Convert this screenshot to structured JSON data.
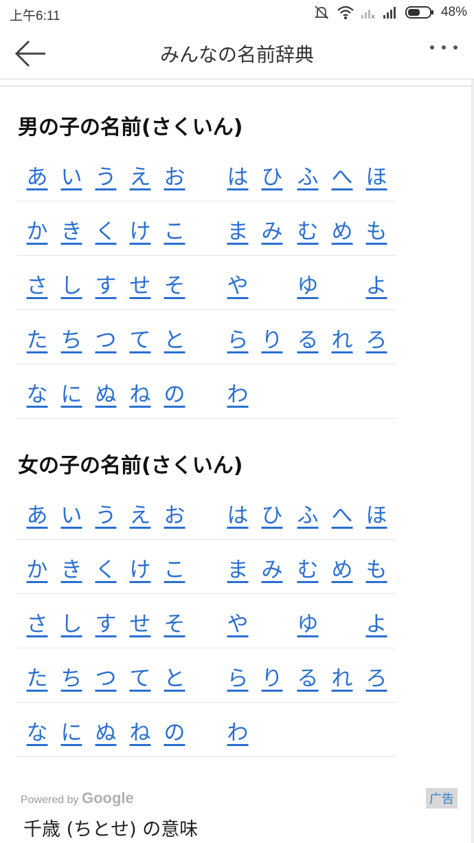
{
  "status_bar": {
    "time": "上午6:11",
    "battery": "48%",
    "icons": [
      "mute-bell-icon",
      "wifi-icon",
      "signal-x-icon",
      "signal-icon",
      "battery-icon"
    ]
  },
  "nav": {
    "title": "みんなの名前辞典",
    "back_icon": "back-arrow-icon",
    "more_icon": "more-dots-icon"
  },
  "sections": [
    {
      "title": "男の子の名前(さくいん)",
      "rows": [
        [
          "あ",
          "い",
          "う",
          "え",
          "お",
          "は",
          "ひ",
          "ふ",
          "へ",
          "ほ"
        ],
        [
          "か",
          "き",
          "く",
          "け",
          "こ",
          "ま",
          "み",
          "む",
          "め",
          "も"
        ],
        [
          "さ",
          "し",
          "す",
          "せ",
          "そ",
          "や",
          "",
          "ゆ",
          "",
          "よ"
        ],
        [
          "た",
          "ち",
          "つ",
          "て",
          "と",
          "ら",
          "り",
          "る",
          "れ",
          "ろ"
        ],
        [
          "な",
          "に",
          "ぬ",
          "ね",
          "の",
          "わ",
          "",
          "",
          "",
          ""
        ]
      ]
    },
    {
      "title": "女の子の名前(さくいん)",
      "rows": [
        [
          "あ",
          "い",
          "う",
          "え",
          "お",
          "は",
          "ひ",
          "ふ",
          "へ",
          "ほ"
        ],
        [
          "か",
          "き",
          "く",
          "け",
          "こ",
          "ま",
          "み",
          "む",
          "め",
          "も"
        ],
        [
          "さ",
          "し",
          "す",
          "せ",
          "そ",
          "や",
          "",
          "ゆ",
          "",
          "よ"
        ],
        [
          "た",
          "ち",
          "つ",
          "て",
          "と",
          "ら",
          "り",
          "る",
          "れ",
          "ろ"
        ],
        [
          "な",
          "に",
          "ぬ",
          "ね",
          "の",
          "わ",
          "",
          "",
          "",
          ""
        ]
      ]
    }
  ],
  "ad": {
    "powered_by": "Powered by",
    "google": "Google",
    "badge": "广告",
    "text": "千歳 (ちとせ) の意味"
  },
  "colors": {
    "link": "#2a6fd1",
    "text": "#222222"
  }
}
